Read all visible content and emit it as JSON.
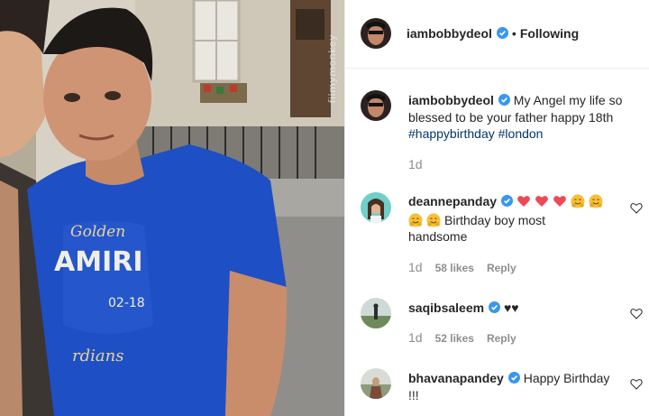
{
  "post": {
    "username": "iambobbydeol",
    "follow_status": "Following",
    "watermark": "filmymonkey",
    "caption": {
      "username": "iambobbydeol",
      "text": "My Angel my life so blessed to be your father happy 18th",
      "hashtags": [
        "#happybirthday",
        "#london"
      ],
      "time": "1d"
    }
  },
  "comments": [
    {
      "username": "deannepanday",
      "emojis_line1": [
        "red-heart",
        "red-heart",
        "red-heart",
        "hugging-face",
        "hugging-face"
      ],
      "emojis_line2": [
        "hugging-face",
        "hugging-face"
      ],
      "text": "Birthday boy most",
      "text_line2": "handsome",
      "time": "1d",
      "likes": "58 likes",
      "reply": "Reply"
    },
    {
      "username": "saqibsaleem",
      "text": "♥♥",
      "time": "1d",
      "likes": "52 likes",
      "reply": "Reply"
    },
    {
      "username": "bhavanapandey",
      "text": "Happy Birthday",
      "text_line2": "!!!"
    }
  ],
  "colors": {
    "verified": "#3897f0",
    "hashtag": "#00376b",
    "muted": "#8e8e8e",
    "shirt": "#1f4fc4",
    "emoji_heart": "#ed4956",
    "emoji_face": "#f7c03a"
  },
  "icons": {
    "verified": "verified-badge-icon",
    "like": "heart-outline-icon"
  }
}
